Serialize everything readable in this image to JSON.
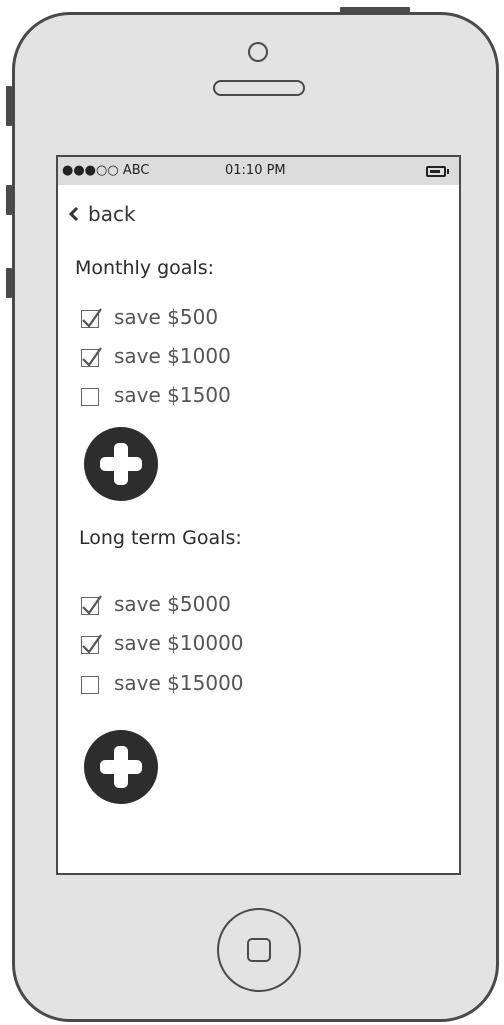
{
  "status_bar": {
    "carrier": "●●●○○ ABC",
    "time": "01:10 PM",
    "battery_icon": "battery-icon"
  },
  "nav": {
    "back_label": "back",
    "back_icon": "chevron-left-icon"
  },
  "monthly": {
    "heading": "Monthly goals:",
    "goals": [
      {
        "label": "save $500",
        "checked": true
      },
      {
        "label": "save $1000",
        "checked": true
      },
      {
        "label": "save $1500",
        "checked": false
      }
    ],
    "add_icon": "plus-circle-icon"
  },
  "long_term": {
    "heading": "Long term Goals:",
    "goals": [
      {
        "label": "save $5000",
        "checked": true
      },
      {
        "label": "save $10000",
        "checked": true
      },
      {
        "label": "save $15000",
        "checked": false
      }
    ],
    "add_icon": "plus-circle-icon"
  },
  "colors": {
    "frame": "#4a4a4a",
    "phone_body": "#e3e3e3",
    "status_bar": "#dcdcdc",
    "add_button": "#2d2d2d"
  }
}
